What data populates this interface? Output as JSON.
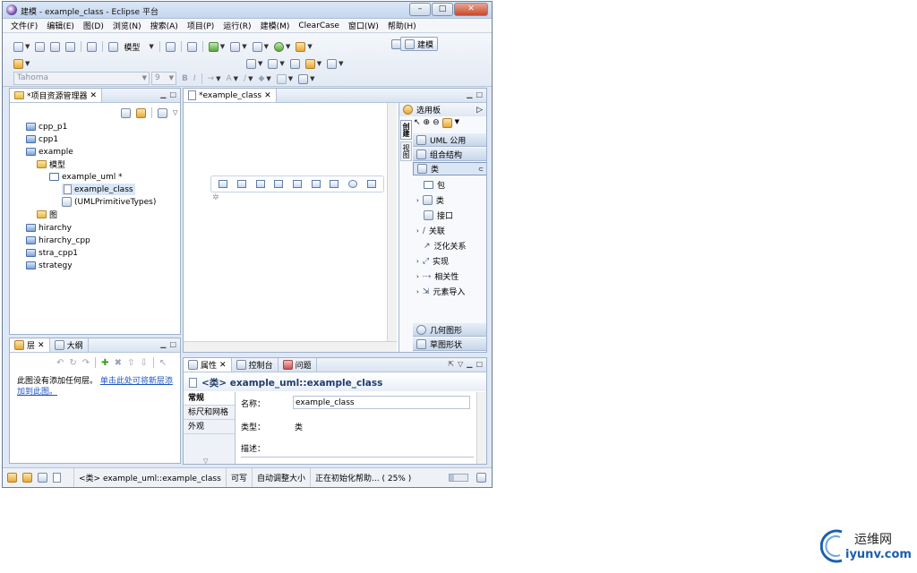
{
  "window": {
    "title": "建模 - example_class - Eclipse 平台",
    "btn_min": "–",
    "btn_max": "□",
    "btn_close": "✕"
  },
  "menubar": [
    "文件(F)",
    "编辑(E)",
    "图(D)",
    "浏览(N)",
    "搜索(A)",
    "项目(P)",
    "运行(R)",
    "建模(M)",
    "ClearCase",
    "窗口(W)",
    "帮助(H)"
  ],
  "toolbar": {
    "model_label": "模型",
    "font": "Tahoma",
    "font_size": "9",
    "bold": "B",
    "italic": "I",
    "text_color": "A",
    "perspective": "建模"
  },
  "explorer": {
    "tab": "*项目资源管理器",
    "items": [
      "cpp_p1",
      "cpp1",
      "example",
      "模型",
      "example_uml *",
      "example_class",
      "(UMLPrimitiveTypes)",
      "图",
      "hirarchy",
      "hirarchy_cpp",
      "stra_cpp1",
      "strategy"
    ]
  },
  "layers": {
    "tab1": "层",
    "tab2": "大纲",
    "message": "此图没有添加任何层。",
    "link": "单击此处可将新层添加到此图。"
  },
  "editor": {
    "tab": "*example_class"
  },
  "palette": {
    "header": "选用板",
    "side_tabs": [
      "创建",
      "视图"
    ],
    "drawers": [
      "UML 公用",
      "组合结构",
      "类"
    ],
    "items": [
      "包",
      "类",
      "接口",
      "关联",
      "泛化关系",
      "实现",
      "相关性",
      "元素导入"
    ],
    "bottom": [
      "几何图形",
      "草图形状"
    ]
  },
  "properties": {
    "tabs": [
      "属性",
      "控制台",
      "问题"
    ],
    "title": "<类> example_uml::example_class",
    "side_tabs": [
      "常规",
      "标尺和网格",
      "外观"
    ],
    "name_label": "名称：",
    "name_value": "example_class",
    "type_label": "类型：",
    "type_value": "类",
    "desc_label": "描述："
  },
  "status": {
    "selection": "<类> example_uml::example_class",
    "mode": "可写",
    "autosize": "自动调整大小",
    "progress": "正在初始化帮助... ( 25% )"
  },
  "watermark": {
    "cn": "运维网",
    "en": "iyunv.com"
  },
  "colors": {
    "accent": "#3a6ea5",
    "link": "#1d56c4",
    "title_bar": "#c4d6ee",
    "watermark": "#1b5fae"
  }
}
